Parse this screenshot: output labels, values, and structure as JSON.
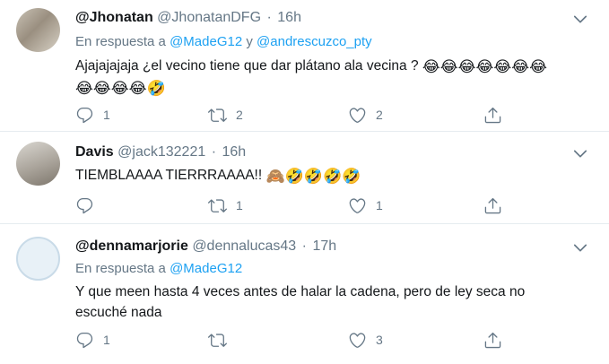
{
  "tweets": [
    {
      "name": "@Jhonatan",
      "handle": "@JhonatanDFG",
      "sep": "·",
      "time": "16h",
      "reply_prefix": "En respuesta a",
      "mention1": "@MadeG12",
      "mention_join": "y",
      "mention2": "@andrescuzco_pty",
      "text": "Ajajajajaja ¿el vecino tiene que dar plátano ala vecina ?",
      "emoji_line1": "😂😂😂😂😂😂😂",
      "emoji_line2": "😂😂😂😂🤣",
      "reply_count": "1",
      "retweet_count": "2",
      "like_count": "2"
    },
    {
      "name": "Davis",
      "handle": "@jack132221",
      "sep": "·",
      "time": "16h",
      "text": "TIEMBLAAAA TIERRRAAAA!!",
      "emojis": "🙈🤣🤣🤣🤣",
      "reply_count": "",
      "retweet_count": "1",
      "like_count": "1"
    },
    {
      "name": "@dennamarjorie",
      "handle": "@dennalucas43",
      "sep": "·",
      "time": "17h",
      "reply_prefix": "En respuesta a",
      "mention1": "@MadeG12",
      "text": "Y que meen hasta 4 veces antes de halar la cadena, pero de ley seca no escuché nada",
      "reply_count": "1",
      "retweet_count": "",
      "like_count": "3"
    }
  ],
  "icons": [
    "reply-icon",
    "retweet-icon",
    "like-icon",
    "share-icon",
    "chevron-down-icon"
  ],
  "colors": {
    "secondary_text": "#657786",
    "mention": "#1da1f2",
    "divider": "#e6ecf0"
  }
}
